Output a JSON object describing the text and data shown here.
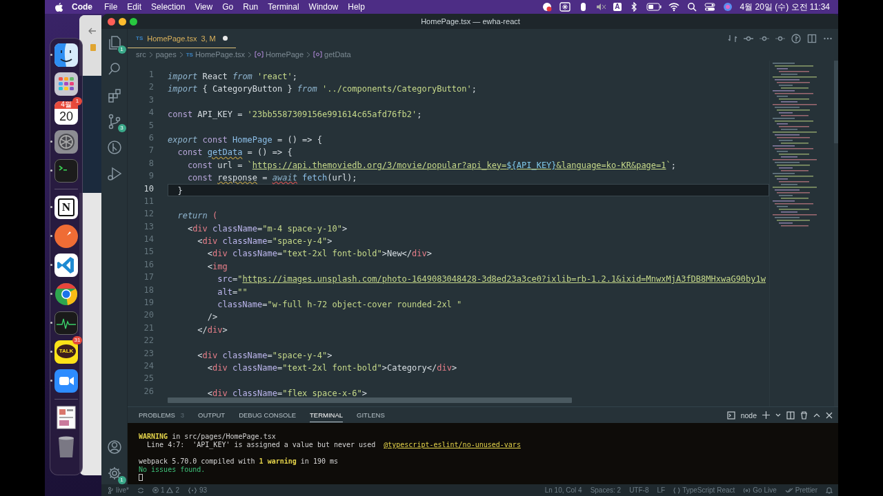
{
  "menu_bar": {
    "app_name": "Code",
    "items": [
      "File",
      "Edit",
      "Selection",
      "View",
      "Go",
      "Run",
      "Terminal",
      "Window",
      "Help"
    ],
    "input_source": "A",
    "clock": "4월 20일 (수) 오전 11:34"
  },
  "dock": {
    "groups": [
      {
        "items": [
          {
            "kind": "finder",
            "running": true
          },
          {
            "kind": "launchpad",
            "running": false
          },
          {
            "kind": "calendar",
            "running": false,
            "month": "4월",
            "day": "20",
            "badge": "1"
          },
          {
            "kind": "settings",
            "running": true
          },
          {
            "kind": "terminal",
            "running": true
          }
        ]
      },
      {
        "items": [
          {
            "kind": "notion",
            "running": true,
            "label": "N"
          },
          {
            "kind": "postman",
            "running": true
          },
          {
            "kind": "vscode",
            "running": true
          },
          {
            "kind": "chrome",
            "running": true
          },
          {
            "kind": "activity",
            "running": true
          },
          {
            "kind": "kakaotalk",
            "running": true,
            "label": "TALK",
            "badge": "31"
          },
          {
            "kind": "zoom",
            "running": true
          }
        ]
      },
      {
        "items": [
          {
            "kind": "preview",
            "running": false
          },
          {
            "kind": "trash",
            "running": false
          }
        ]
      }
    ]
  },
  "editor_window": {
    "title": "HomePage.tsx — ewha-react",
    "activity_bar": {
      "top": [
        {
          "kind": "explorer",
          "badge": "1"
        },
        {
          "kind": "search"
        },
        {
          "kind": "extensions"
        },
        {
          "kind": "source-control",
          "badge": "3"
        },
        {
          "kind": "git-graph"
        },
        {
          "kind": "run-debug"
        }
      ],
      "bottom": [
        {
          "kind": "account"
        },
        {
          "kind": "settings",
          "badge": "1"
        }
      ]
    },
    "tabs": [
      {
        "file_type": "TS",
        "name": "HomePage.tsx",
        "status": "3, M",
        "modified": true,
        "selected": true
      }
    ],
    "breadcrumbs": [
      {
        "kind": "folder",
        "text": "src"
      },
      {
        "kind": "folder",
        "text": "pages"
      },
      {
        "kind": "file",
        "file_type": "TS",
        "text": "HomePage.tsx"
      },
      {
        "kind": "symbol",
        "text": "HomePage"
      },
      {
        "kind": "symbol",
        "text": "getData"
      }
    ],
    "code_lines": [
      {
        "number": "1",
        "current": false,
        "tokens": [
          {
            "kind": "keyword",
            "text": "import"
          },
          {
            "kind": "plain",
            "text": " React "
          },
          {
            "kind": "keyword",
            "text": "from "
          },
          {
            "kind": "string",
            "text": "'react'"
          },
          {
            "kind": "plain",
            "text": ";"
          }
        ]
      },
      {
        "number": "2",
        "current": false,
        "tokens": [
          {
            "kind": "keyword",
            "text": "import"
          },
          {
            "kind": "plain",
            "text": " { CategoryButton } "
          },
          {
            "kind": "keyword",
            "text": "from "
          },
          {
            "kind": "string",
            "text": "'../components/CategoryButton'"
          },
          {
            "kind": "plain",
            "text": ";"
          }
        ]
      },
      {
        "number": "3",
        "current": false
      },
      {
        "number": "4",
        "current": false,
        "tokens": [
          {
            "kind": "storage",
            "text": "const"
          },
          {
            "kind": "plain",
            "text": " API_KEY = "
          },
          {
            "kind": "string",
            "text": "'23bb5587309156e991614c65afd76fb2'"
          },
          {
            "kind": "plain",
            "text": ";"
          }
        ]
      },
      {
        "number": "5",
        "current": false
      },
      {
        "number": "6",
        "current": false,
        "tokens": [
          {
            "kind": "keyword",
            "text": "export "
          },
          {
            "kind": "storage",
            "text": "const "
          },
          {
            "kind": "function",
            "text": "HomePage"
          },
          {
            "kind": "plain",
            "text": " = () => {"
          }
        ]
      },
      {
        "number": "7",
        "current": false,
        "tokens": [
          {
            "kind": "storage",
            "text": "  const "
          },
          {
            "kind": "function_warning",
            "text": "getData"
          },
          {
            "kind": "plain",
            "text": " = () => {"
          }
        ]
      },
      {
        "number": "8",
        "current": false,
        "tokens": [
          {
            "kind": "storage",
            "text": "    const"
          },
          {
            "kind": "plain",
            "text": " url = "
          },
          {
            "kind": "string",
            "text": "`"
          },
          {
            "kind": "link",
            "text": "https://api.themoviedb.org/3/movie/popular?api_key="
          },
          {
            "kind": "interpolation",
            "text": "${API_KEY}"
          },
          {
            "kind": "link",
            "text": "&language=ko-KR&page=1"
          },
          {
            "kind": "string",
            "text": "`"
          },
          {
            "kind": "plain",
            "text": ";"
          }
        ]
      },
      {
        "number": "9",
        "current": false,
        "tokens": [
          {
            "kind": "storage",
            "text": "    const "
          },
          {
            "kind": "variable_warning",
            "text": "response"
          },
          {
            "kind": "plain",
            "text": " = "
          },
          {
            "kind": "keyword_error",
            "text": "await"
          },
          {
            "kind": "function",
            "text": " fetch"
          },
          {
            "kind": "plain",
            "text": "(url);"
          }
        ]
      },
      {
        "number": "10",
        "current": true,
        "tokens": [
          {
            "kind": "plain",
            "text": "  }"
          }
        ]
      },
      {
        "number": "11",
        "current": false
      },
      {
        "number": "12",
        "current": false,
        "tokens": [
          {
            "kind": "keyword",
            "text": "  return "
          },
          {
            "kind": "paren",
            "text": "("
          }
        ]
      },
      {
        "number": "13",
        "current": false,
        "tokens": [
          {
            "kind": "plain",
            "text": "    <"
          },
          {
            "kind": "tag",
            "text": "div "
          },
          {
            "kind": "attribute",
            "text": "className"
          },
          {
            "kind": "plain",
            "text": "="
          },
          {
            "kind": "string",
            "text": "\"m-4 space-y-10\""
          },
          {
            "kind": "plain",
            "text": ">"
          }
        ]
      },
      {
        "number": "14",
        "current": false,
        "tokens": [
          {
            "kind": "plain",
            "text": "      <"
          },
          {
            "kind": "tag",
            "text": "div "
          },
          {
            "kind": "attribute",
            "text": "className"
          },
          {
            "kind": "plain",
            "text": "="
          },
          {
            "kind": "string",
            "text": "\"space-y-4\""
          },
          {
            "kind": "plain",
            "text": ">"
          }
        ]
      },
      {
        "number": "15",
        "current": false,
        "tokens": [
          {
            "kind": "plain",
            "text": "        <"
          },
          {
            "kind": "tag",
            "text": "div "
          },
          {
            "kind": "attribute",
            "text": "className"
          },
          {
            "kind": "plain",
            "text": "="
          },
          {
            "kind": "string",
            "text": "\"text-2xl font-bold\""
          },
          {
            "kind": "plain",
            "text": ">New</"
          },
          {
            "kind": "tag",
            "text": "div"
          },
          {
            "kind": "plain",
            "text": ">"
          }
        ]
      },
      {
        "number": "16",
        "current": false,
        "tokens": [
          {
            "kind": "plain",
            "text": "        <"
          },
          {
            "kind": "tag",
            "text": "img"
          }
        ]
      },
      {
        "number": "17",
        "current": false,
        "tokens": [
          {
            "kind": "attribute",
            "text": "          src"
          },
          {
            "kind": "plain",
            "text": "="
          },
          {
            "kind": "string",
            "text": "\""
          },
          {
            "kind": "link",
            "text": "https://images.unsplash.com/photo-1649083048428-3d8ed23a3ce0?ixlib=rb-1.2.1&ixid=MnwxMjA3fDB8MHxwaG90by1w"
          }
        ]
      },
      {
        "number": "18",
        "current": false,
        "tokens": [
          {
            "kind": "attribute",
            "text": "          alt"
          },
          {
            "kind": "plain",
            "text": "="
          },
          {
            "kind": "string",
            "text": "\"\""
          }
        ]
      },
      {
        "number": "19",
        "current": false,
        "tokens": [
          {
            "kind": "attribute",
            "text": "          className"
          },
          {
            "kind": "plain",
            "text": "="
          },
          {
            "kind": "string",
            "text": "\"w-full h-72 object-cover rounded-2xl \""
          }
        ]
      },
      {
        "number": "20",
        "current": false,
        "tokens": [
          {
            "kind": "plain",
            "text": "        />"
          }
        ]
      },
      {
        "number": "21",
        "current": false,
        "tokens": [
          {
            "kind": "plain",
            "text": "      </"
          },
          {
            "kind": "tag",
            "text": "div"
          },
          {
            "kind": "plain",
            "text": ">"
          }
        ]
      },
      {
        "number": "22",
        "current": false
      },
      {
        "number": "23",
        "current": false,
        "tokens": [
          {
            "kind": "plain",
            "text": "      <"
          },
          {
            "kind": "tag",
            "text": "div "
          },
          {
            "kind": "attribute",
            "text": "className"
          },
          {
            "kind": "plain",
            "text": "="
          },
          {
            "kind": "string",
            "text": "\"space-y-4\""
          },
          {
            "kind": "plain",
            "text": ">"
          }
        ]
      },
      {
        "number": "24",
        "current": false,
        "tokens": [
          {
            "kind": "plain",
            "text": "        <"
          },
          {
            "kind": "tag",
            "text": "div "
          },
          {
            "kind": "attribute",
            "text": "className"
          },
          {
            "kind": "plain",
            "text": "="
          },
          {
            "kind": "string",
            "text": "\"text-2xl font-bold\""
          },
          {
            "kind": "plain",
            "text": ">Category</"
          },
          {
            "kind": "tag",
            "text": "div"
          },
          {
            "kind": "plain",
            "text": ">"
          }
        ]
      },
      {
        "number": "25",
        "current": false
      },
      {
        "number": "26",
        "current": false,
        "tokens": [
          {
            "kind": "plain",
            "text": "        <"
          },
          {
            "kind": "tag",
            "text": "div "
          },
          {
            "kind": "attribute",
            "text": "className"
          },
          {
            "kind": "plain",
            "text": "="
          },
          {
            "kind": "string",
            "text": "\"flex space-x-6\""
          },
          {
            "kind": "plain",
            "text": ">"
          }
        ]
      }
    ],
    "panel": {
      "tabs": [
        {
          "label": "PROBLEMS",
          "badge": "3",
          "selected": false
        },
        {
          "label": "OUTPUT",
          "selected": false
        },
        {
          "label": "DEBUG CONSOLE",
          "selected": false
        },
        {
          "label": "TERMINAL",
          "selected": true
        },
        {
          "label": "GITLENS",
          "selected": false
        }
      ],
      "terminal_name": "node",
      "terminal_lines": [
        {
          "segments": [
            {
              "kind": "warning",
              "text": "WARNING"
            },
            {
              "kind": "plain",
              "text": " in src/pages/HomePage.tsx"
            }
          ]
        },
        {
          "segments": [
            {
              "kind": "plain",
              "text": "  Line 4:7:  'API_KEY' is assigned a value but never used  "
            },
            {
              "kind": "rule",
              "text": "@typescript-eslint/no-unused-vars"
            }
          ]
        },
        {
          "kind": "blank"
        },
        {
          "segments": [
            {
              "kind": "plain",
              "text": "webpack 5.70.0 compiled with "
            },
            {
              "kind": "highlight",
              "text": "1 warning"
            },
            {
              "kind": "plain",
              "text": " in 190 ms"
            }
          ]
        },
        {
          "segments": [
            {
              "kind": "success",
              "text": "No issues found."
            }
          ]
        },
        {
          "kind": "prompt"
        }
      ]
    },
    "status_bar": {
      "left": [
        {
          "kind": "branch",
          "text": "live*"
        },
        {
          "kind": "sync"
        },
        {
          "kind": "problems",
          "errors": "1",
          "warnings": "2"
        },
        {
          "kind": "braces",
          "text": "93"
        }
      ],
      "right": [
        {
          "kind": "text",
          "text": "Ln 10, Col 4"
        },
        {
          "kind": "text",
          "text": "Spaces: 2"
        },
        {
          "kind": "text",
          "text": "UTF-8"
        },
        {
          "kind": "text",
          "text": "LF"
        },
        {
          "kind": "language",
          "text": "TypeScript React"
        },
        {
          "kind": "golive",
          "text": "Go Live"
        },
        {
          "kind": "prettier",
          "text": "Prettier"
        },
        {
          "kind": "bell"
        }
      ]
    }
  }
}
